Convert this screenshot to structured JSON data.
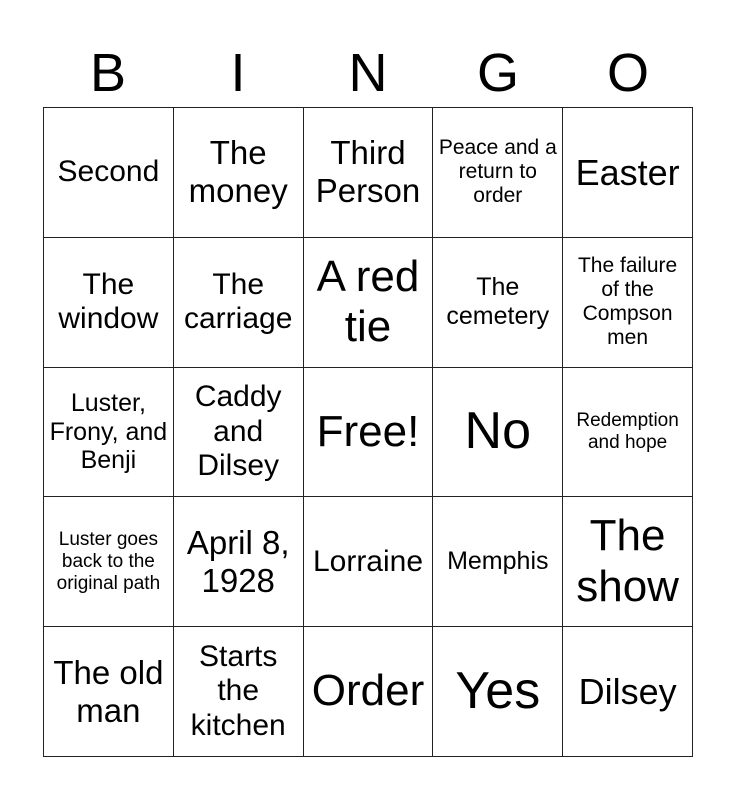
{
  "header": [
    "B",
    "I",
    "N",
    "G",
    "O"
  ],
  "cells": [
    [
      "Second",
      "The money",
      "Third Person",
      "Peace and a return to order",
      "Easter"
    ],
    [
      "The window",
      "The carriage",
      "A red tie",
      "The cemetery",
      "The failure of the Compson men"
    ],
    [
      "Luster, Frony, and Benji",
      "Caddy and Dilsey",
      "Free!",
      "No",
      "Redemption and hope"
    ],
    [
      "Luster goes back to the original path",
      "April 8, 1928",
      "Lorraine",
      "Memphis",
      "The show"
    ],
    [
      "The old man",
      "Starts the kitchen",
      "Order",
      "Yes",
      "Dilsey"
    ]
  ]
}
